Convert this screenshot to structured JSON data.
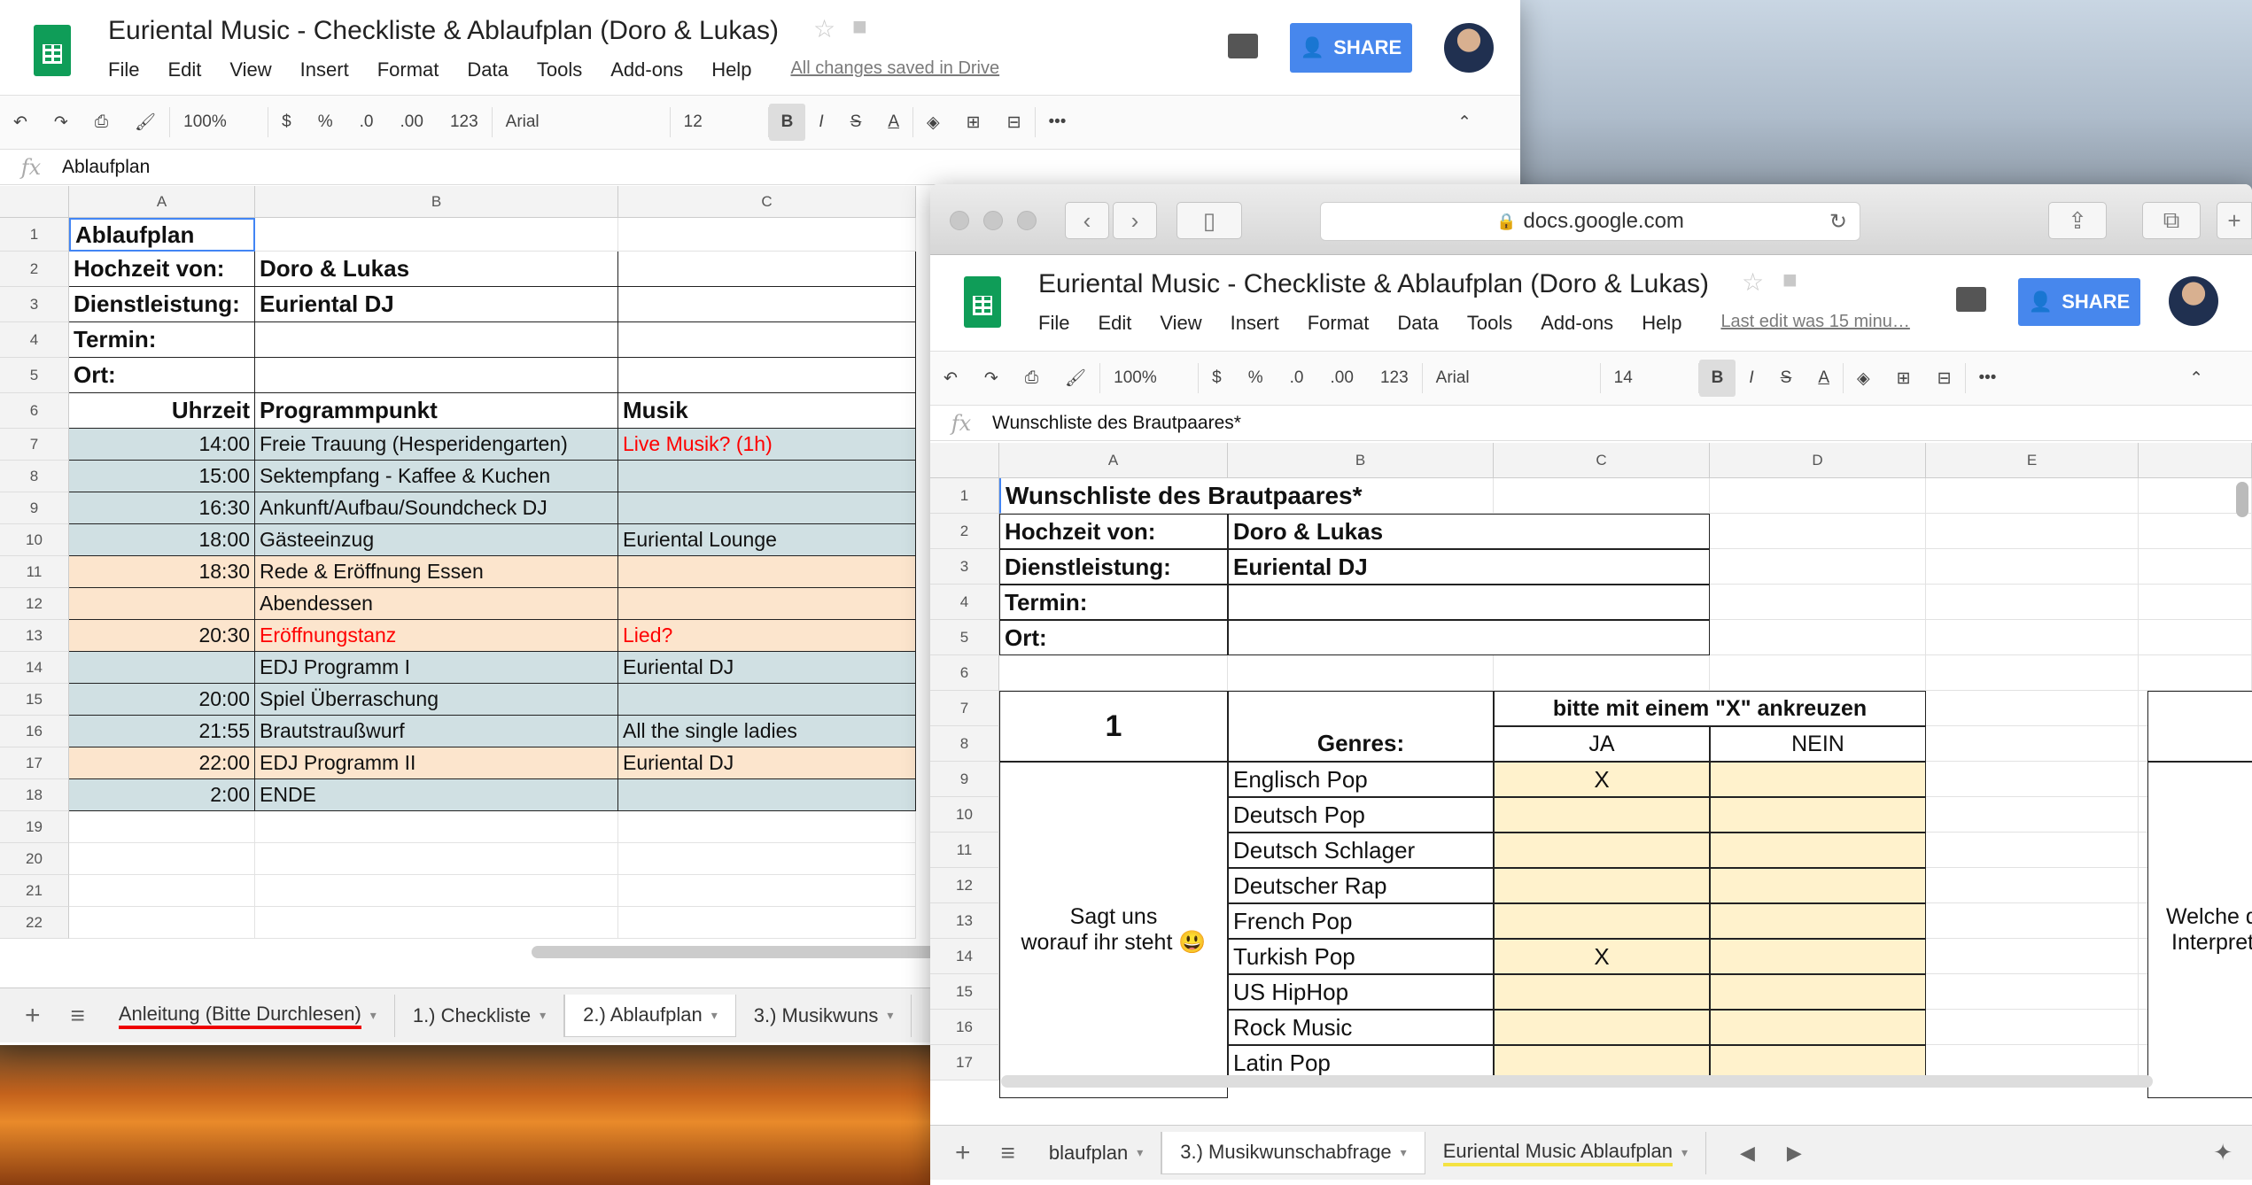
{
  "w1": {
    "title": "Euriental Music - Checkliste & Ablaufplan (Doro & Lukas)",
    "menu": [
      "File",
      "Edit",
      "View",
      "Insert",
      "Format",
      "Data",
      "Tools",
      "Add-ons",
      "Help"
    ],
    "saved": "All changes saved in Drive",
    "share": "SHARE",
    "toolbar": {
      "zoom": "100%",
      "currency": "$",
      "percent": "%",
      "dec_less": ".0",
      "dec_more": ".00",
      "numfmt": "123",
      "font": "Arial",
      "size": "12",
      "bold": "B",
      "italic": "I",
      "strike": "S",
      "color": "A",
      "more": "•••"
    },
    "formula": "Ablaufplan",
    "cols": [
      "A",
      "B",
      "C"
    ],
    "rows": [
      {
        "n": "1",
        "a": "Ablaufplan",
        "b": "",
        "c": ""
      },
      {
        "n": "2",
        "a": "Hochzeit von:",
        "b": "Doro & Lukas",
        "c": ""
      },
      {
        "n": "3",
        "a": "Dienstleistung:",
        "b": "Euriental DJ",
        "c": ""
      },
      {
        "n": "4",
        "a": "Termin:",
        "b": "",
        "c": ""
      },
      {
        "n": "5",
        "a": "Ort:",
        "b": "",
        "c": ""
      },
      {
        "n": "6",
        "a": "Uhrzeit",
        "b": "Programmpunkt",
        "c": "Musik"
      },
      {
        "n": "7",
        "a": "14:00",
        "b": "Freie Trauung (Hesperidengarten)",
        "c": "Live Musik? (1h)"
      },
      {
        "n": "8",
        "a": "15:00",
        "b": "Sektempfang - Kaffee & Kuchen",
        "c": ""
      },
      {
        "n": "9",
        "a": "16:30",
        "b": "Ankunft/Aufbau/Soundcheck DJ",
        "c": ""
      },
      {
        "n": "10",
        "a": "18:00",
        "b": "Gästeeinzug",
        "c": "Euriental Lounge"
      },
      {
        "n": "11",
        "a": "18:30",
        "b": "Rede & Eröffnung Essen",
        "c": ""
      },
      {
        "n": "12",
        "a": "",
        "b": "Abendessen",
        "c": ""
      },
      {
        "n": "13",
        "a": "20:30",
        "b": "Eröffnungstanz",
        "c": "Lied?"
      },
      {
        "n": "14",
        "a": "",
        "b": "EDJ Programm I",
        "c": "Euriental DJ"
      },
      {
        "n": "15",
        "a": "20:00",
        "b": "Spiel Überraschung",
        "c": ""
      },
      {
        "n": "16",
        "a": "21:55",
        "b": "Brautstraußwurf",
        "c": "All the single ladies"
      },
      {
        "n": "17",
        "a": "22:00",
        "b": "EDJ Programm II",
        "c": "Euriental DJ"
      },
      {
        "n": "18",
        "a": "2:00",
        "b": "ENDE",
        "c": ""
      },
      {
        "n": "19",
        "a": "",
        "b": "",
        "c": ""
      },
      {
        "n": "20",
        "a": "",
        "b": "",
        "c": ""
      },
      {
        "n": "21",
        "a": "",
        "b": "",
        "c": ""
      },
      {
        "n": "22",
        "a": "",
        "b": "",
        "c": ""
      }
    ],
    "tabs": [
      "Anleitung (Bitte Durchlesen)",
      "1.) Checkliste",
      "2.) Ablaufplan",
      "3.) Musikwuns"
    ]
  },
  "w2": {
    "url": "docs.google.com",
    "title": "Euriental Music - Checkliste & Ablaufplan (Doro & Lukas)",
    "menu": [
      "File",
      "Edit",
      "View",
      "Insert",
      "Format",
      "Data",
      "Tools",
      "Add-ons",
      "Help"
    ],
    "saved": "Last edit was 15 minu…",
    "share": "SHARE",
    "toolbar": {
      "zoom": "100%",
      "currency": "$",
      "percent": "%",
      "dec_less": ".0",
      "dec_more": ".00",
      "numfmt": "123",
      "font": "Arial",
      "size": "14",
      "bold": "B",
      "italic": "I",
      "strike": "S",
      "color": "A",
      "more": "•••"
    },
    "formula": "Wunschliste des Brautpaares*",
    "cols": [
      "A",
      "B",
      "C",
      "D",
      "E"
    ],
    "heading": "Wunschliste des Brautpaares*",
    "info": [
      {
        "label": "Hochzeit von:",
        "value": "Doro & Lukas"
      },
      {
        "label": "Dienstleistung:",
        "value": "Euriental DJ"
      },
      {
        "label": "Termin:",
        "value": ""
      },
      {
        "label": "Ort:",
        "value": ""
      }
    ],
    "rownums": [
      "1",
      "2",
      "3",
      "4",
      "5",
      "6",
      "7",
      "8",
      "9",
      "10",
      "11",
      "12",
      "13",
      "14",
      "15",
      "16",
      "17"
    ],
    "section_no": "1",
    "genres_head": "Genres:",
    "mark_head": "bitte mit einem \"X\" ankreuzen",
    "ja": "JA",
    "nein": "NEIN",
    "side_text_1": "Sagt uns",
    "side_text_2": "worauf ihr steht 😃",
    "right_text_1": "Welche d",
    "right_text_2": "Interpret",
    "genres": [
      {
        "name": "Englisch Pop",
        "ja": "X",
        "nein": ""
      },
      {
        "name": "Deutsch Pop",
        "ja": "",
        "nein": ""
      },
      {
        "name": "Deutsch Schlager",
        "ja": "",
        "nein": ""
      },
      {
        "name": "Deutscher Rap",
        "ja": "",
        "nein": ""
      },
      {
        "name": "French Pop",
        "ja": "",
        "nein": ""
      },
      {
        "name": "Turkish Pop",
        "ja": "X",
        "nein": ""
      },
      {
        "name": "US HipHop",
        "ja": "",
        "nein": ""
      },
      {
        "name": "Rock Music",
        "ja": "",
        "nein": ""
      },
      {
        "name": "Latin Pop",
        "ja": "",
        "nein": ""
      }
    ],
    "tabs": [
      "blaufplan",
      "3.) Musikwunschabfrage",
      "Euriental Music Ablaufplan"
    ]
  },
  "colors": {
    "blue_row": "#d0e0e3",
    "orange_row": "#fce5cd",
    "red_text": "#ff0000",
    "genre_fill": "#fff2cc",
    "share_blue": "#4787ed"
  }
}
